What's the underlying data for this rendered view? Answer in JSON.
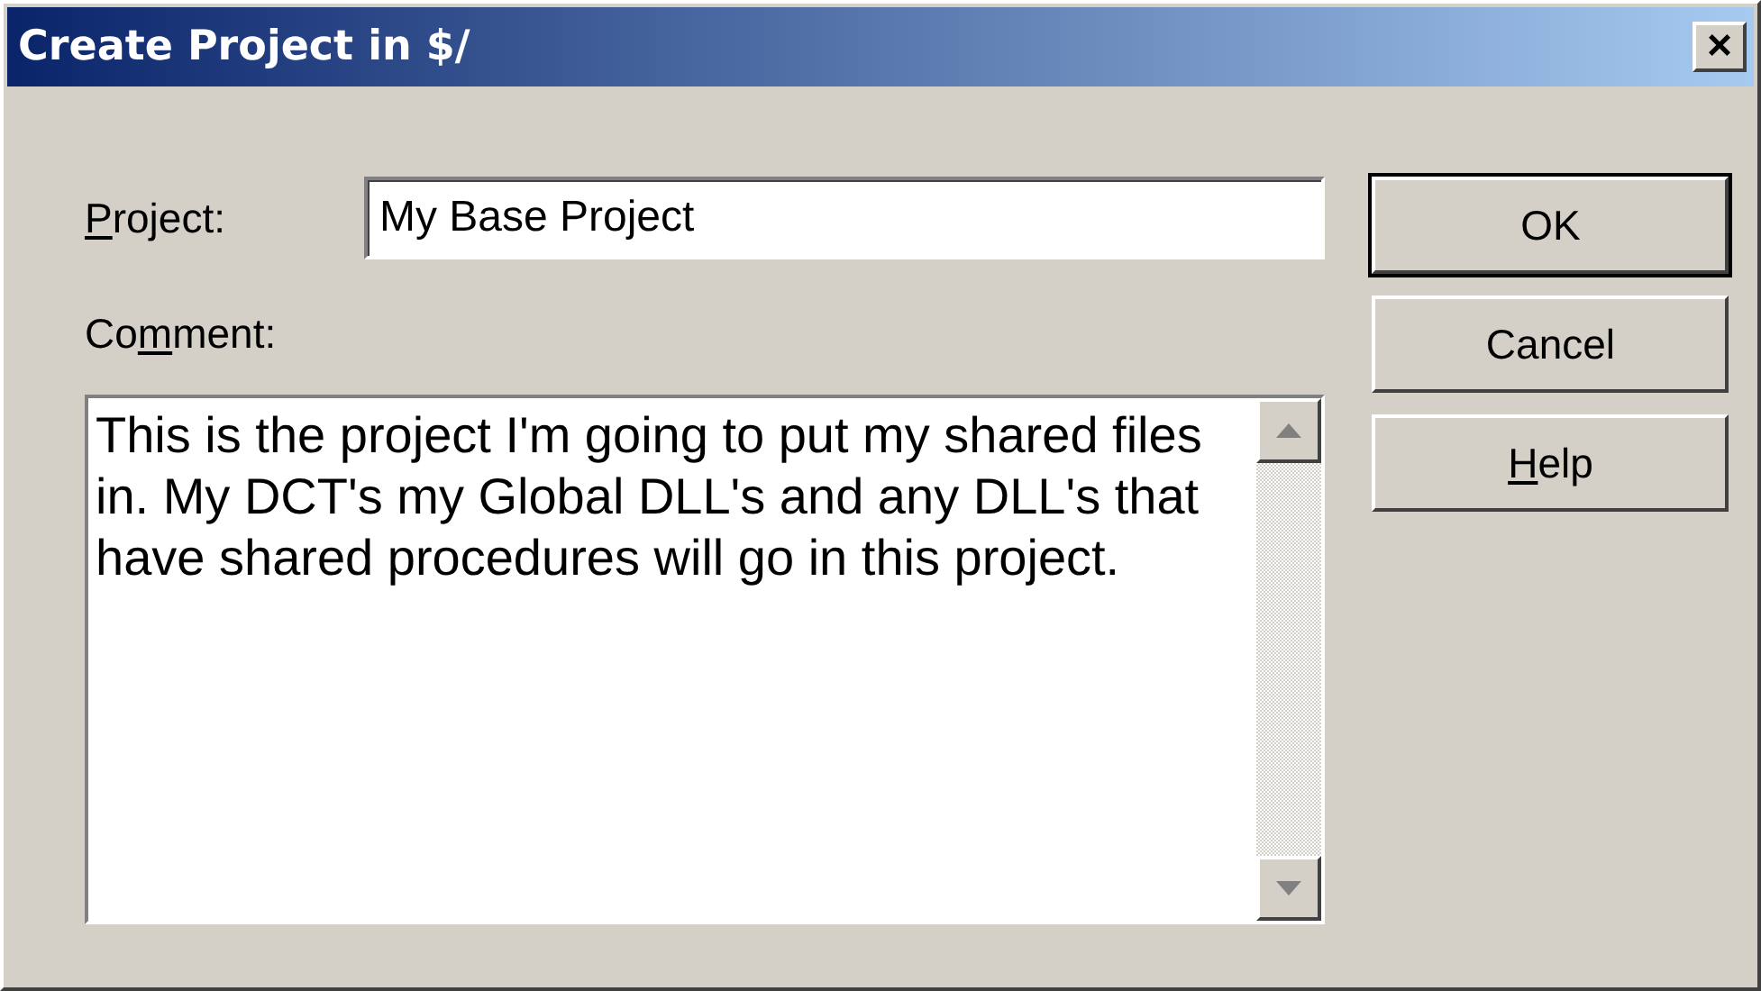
{
  "window": {
    "title": "Create Project in $/",
    "close": "×"
  },
  "project": {
    "access_key": "P",
    "label_after": "roject:",
    "value": "My Base Project"
  },
  "comment": {
    "label_before": "Co",
    "access_key": "m",
    "label_after": "ment:",
    "value": "This is the project I'm going to put my shared files in. My DCT's my Global DLL's and any DLL's that have shared procedures will go in this project."
  },
  "buttons": [
    {
      "label_after": "OK",
      "default": true
    },
    {
      "label_after": "Cancel",
      "default": false
    },
    {
      "access_key": "H",
      "label_after": "elp",
      "default": false
    }
  ]
}
